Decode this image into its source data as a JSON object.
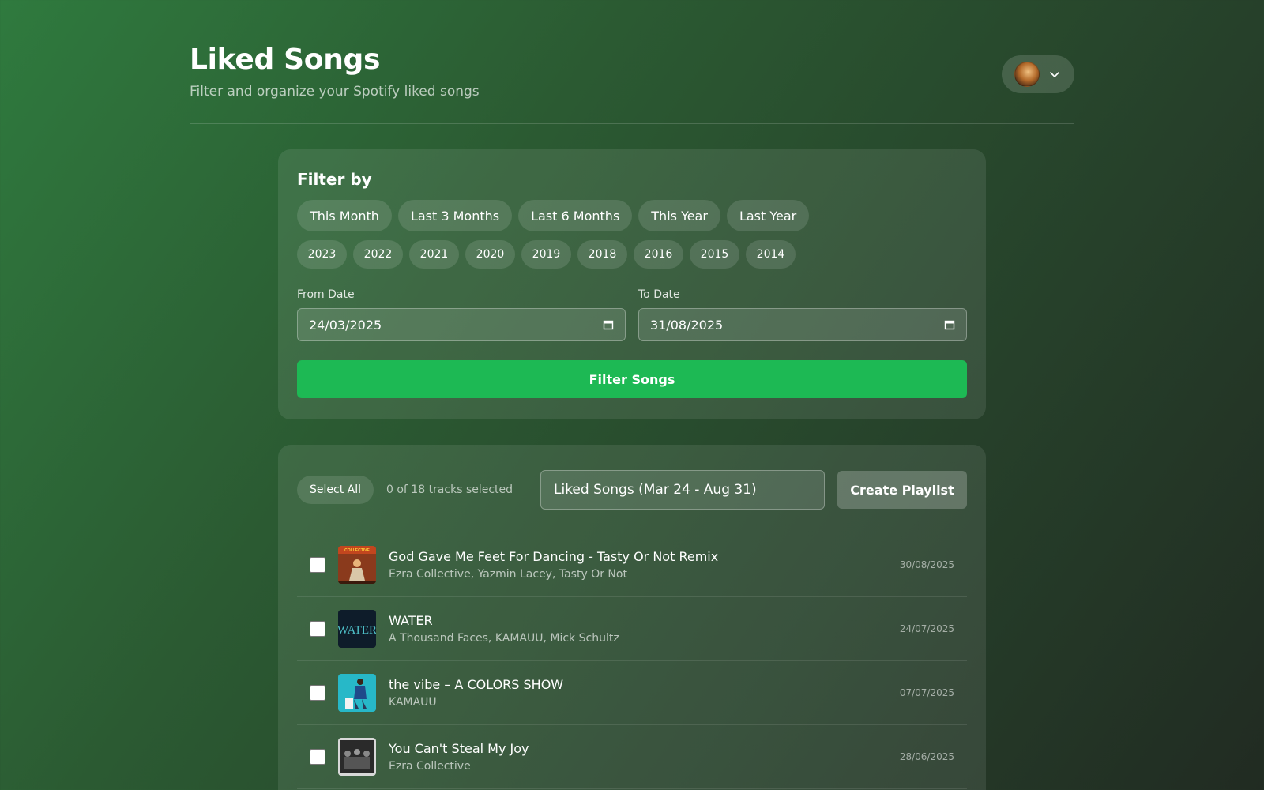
{
  "header": {
    "title": "Liked Songs",
    "subtitle": "Filter and organize your Spotify liked songs"
  },
  "user_menu": {
    "avatar": "avatar-image",
    "chevron": "chevron-down-icon"
  },
  "filter": {
    "heading": "Filter by",
    "quick_filters": [
      "This Month",
      "Last 3 Months",
      "Last 6 Months",
      "This Year",
      "Last Year"
    ],
    "years": [
      "2023",
      "2022",
      "2021",
      "2020",
      "2019",
      "2018",
      "2016",
      "2015",
      "2014"
    ],
    "from_label": "From Date",
    "from_value": "24/03/2025",
    "to_label": "To Date",
    "to_value": "31/08/2025",
    "filter_button": "Filter Songs"
  },
  "tracks": {
    "select_all": "Select All",
    "selected_count": "0 of 18 tracks selected",
    "playlist_name": "Liked Songs (Mar 24 - Aug 31)",
    "create_button": "Create Playlist",
    "items": [
      {
        "name": "God Gave Me Feet For Dancing - Tasty Or Not Remix",
        "artist": "Ezra Collective, Yazmin Lacey, Tasty Or Not",
        "date": "30/08/2025",
        "art_text": "COLLECTIVE"
      },
      {
        "name": "WATER",
        "artist": "A Thousand Faces, KAMAUU, Mick Schultz",
        "date": "24/07/2025",
        "art_text": "WATER"
      },
      {
        "name": "the vibe – A COLORS SHOW",
        "artist": "KAMAUU",
        "date": "07/07/2025",
        "art_text": ""
      },
      {
        "name": "You Can't Steal My Joy",
        "artist": "Ezra Collective",
        "date": "28/06/2025",
        "art_text": ""
      }
    ]
  },
  "colors": {
    "accent": "#1db954"
  }
}
